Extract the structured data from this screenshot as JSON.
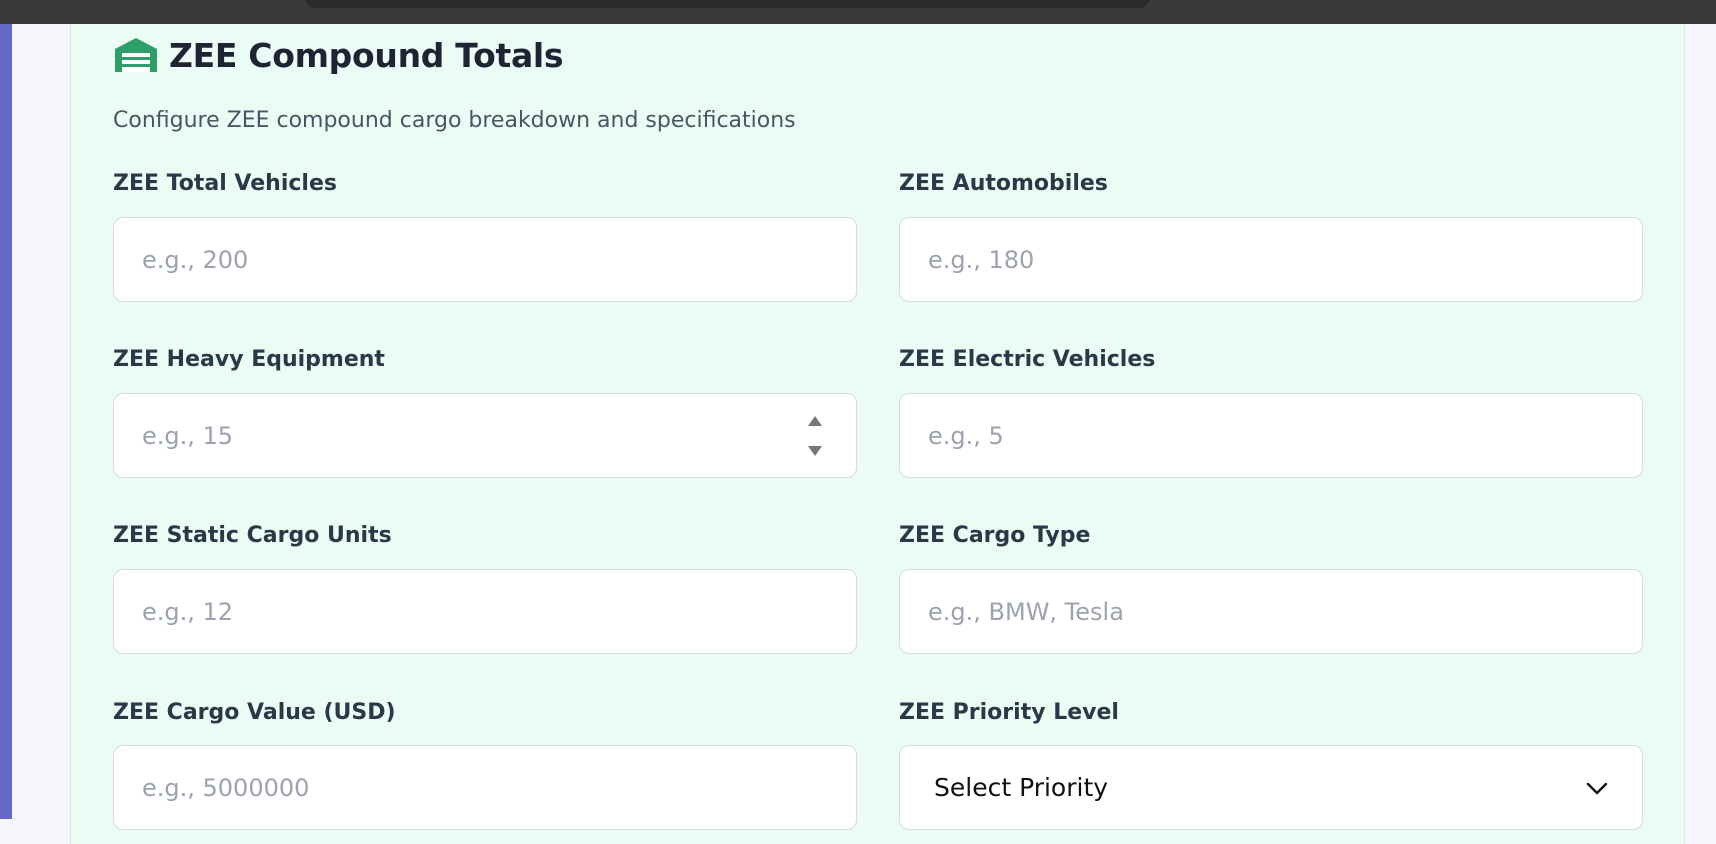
{
  "section": {
    "title": "ZEE Compound Totals",
    "subtitle": "Configure ZEE compound cargo breakdown and specifications",
    "icon": "warehouse-icon",
    "accent_color": "#2e9e6b"
  },
  "fields": {
    "total_vehicles": {
      "label": "ZEE Total Vehicles",
      "placeholder": "e.g., 200"
    },
    "automobiles": {
      "label": "ZEE Automobiles",
      "placeholder": "e.g., 180"
    },
    "heavy_equipment": {
      "label": "ZEE Heavy Equipment",
      "placeholder": "e.g., 15"
    },
    "electric_vehicles": {
      "label": "ZEE Electric Vehicles",
      "placeholder": "e.g., 5"
    },
    "static_cargo_units": {
      "label": "ZEE Static Cargo Units",
      "placeholder": "e.g., 12"
    },
    "cargo_type": {
      "label": "ZEE Cargo Type",
      "placeholder": "e.g., BMW, Tesla"
    },
    "cargo_value": {
      "label": "ZEE Cargo Value (USD)",
      "placeholder": "e.g., 5000000"
    },
    "priority_level": {
      "label": "ZEE Priority Level",
      "selected": "Select Priority",
      "icon": "chevron-down-icon"
    }
  },
  "colors": {
    "panel_background": "#ebfcf4",
    "sidebar_accent": "#6466c8",
    "title_color": "#1e2433"
  }
}
